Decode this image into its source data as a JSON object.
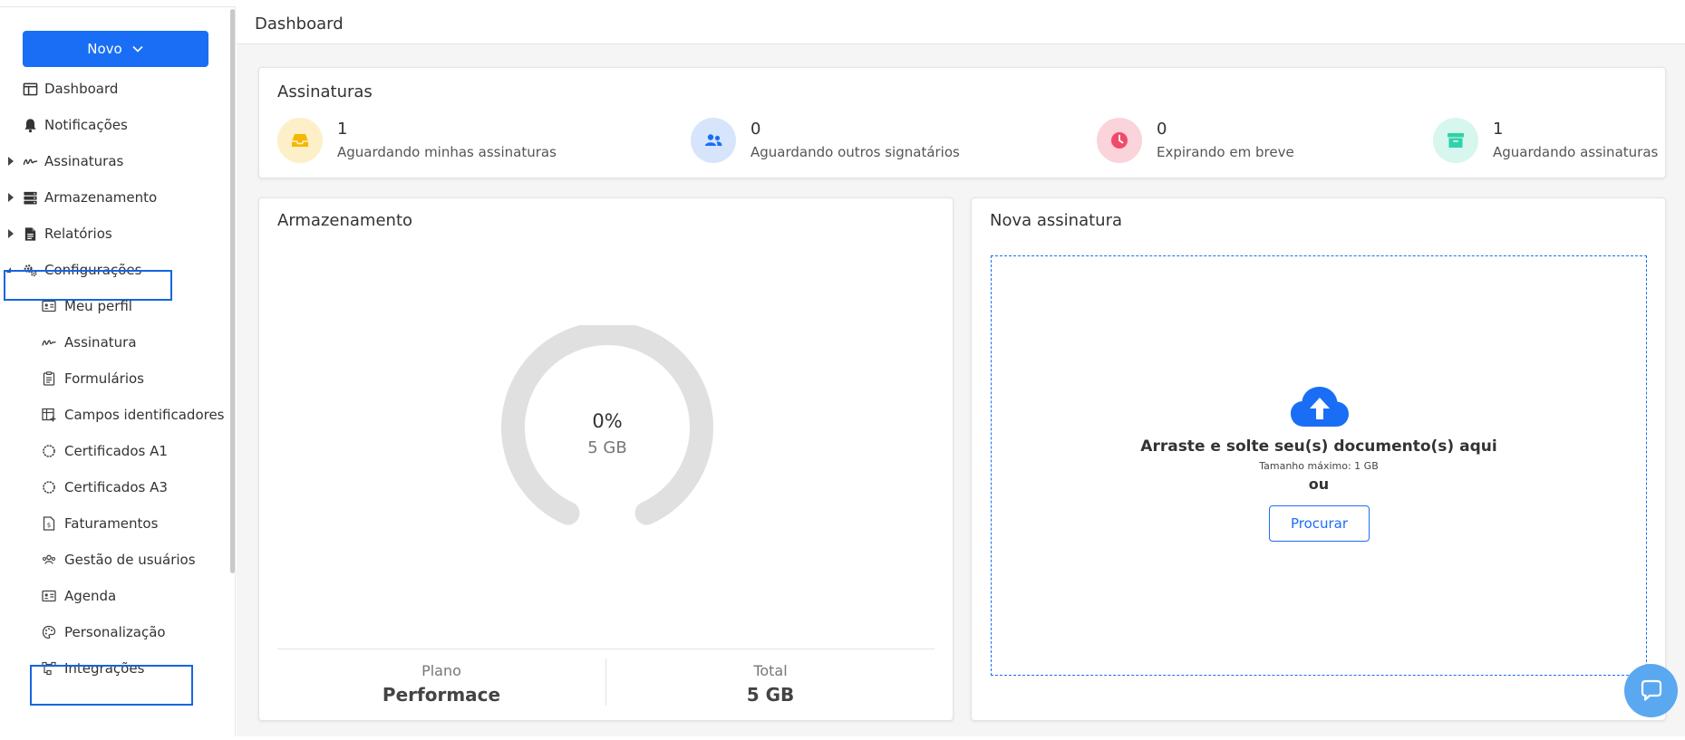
{
  "sidebar": {
    "new_button": "Novo",
    "items": [
      {
        "label": "Dashboard",
        "icon": "dashboard-icon"
      },
      {
        "label": "Notificações",
        "icon": "bell-icon"
      },
      {
        "label": "Assinaturas",
        "icon": "signature-icon",
        "collapsed": true
      },
      {
        "label": "Armazenamento",
        "icon": "storage-icon",
        "collapsed": true
      },
      {
        "label": "Relatórios",
        "icon": "report-icon",
        "collapsed": true
      },
      {
        "label": "Configurações",
        "icon": "gears-icon",
        "expanded": true
      }
    ],
    "sub_items": [
      {
        "label": "Meu perfil",
        "icon": "id-card-icon"
      },
      {
        "label": "Assinatura",
        "icon": "signature-icon"
      },
      {
        "label": "Formulários",
        "icon": "clipboard-icon"
      },
      {
        "label": "Campos identificadores",
        "icon": "table-plus-icon"
      },
      {
        "label": "Certificados A1",
        "icon": "certificate-icon"
      },
      {
        "label": "Certificados A3",
        "icon": "certificate-icon"
      },
      {
        "label": "Faturamentos",
        "icon": "invoice-icon"
      },
      {
        "label": "Gestão de usuários",
        "icon": "users-gear-icon"
      },
      {
        "label": "Agenda",
        "icon": "id-card-icon"
      },
      {
        "label": "Personalização",
        "icon": "palette-icon"
      },
      {
        "label": "Integrações",
        "icon": "integration-icon"
      }
    ]
  },
  "header": {
    "title": "Dashboard"
  },
  "signatures": {
    "title": "Assinaturas",
    "stats": [
      {
        "value": "1",
        "label": "Aguardando minhas assinaturas",
        "icon": "inbox-icon",
        "color": "#f5b800",
        "bg": "#fdf0c8"
      },
      {
        "value": "0",
        "label": "Aguardando outros signatários",
        "icon": "users-icon",
        "color": "#1a6ef5",
        "bg": "#d6e5fb"
      },
      {
        "value": "0",
        "label": "Expirando em breve",
        "icon": "clock-icon",
        "color": "#f04a6b",
        "bg": "#fbd3db"
      },
      {
        "value": "1",
        "label": "Aguardando assinaturas",
        "icon": "archive-icon",
        "color": "#2ed3a8",
        "bg": "#d6f6ee"
      }
    ]
  },
  "storage": {
    "title": "Armazenamento",
    "percent": "0%",
    "used_fraction": 0,
    "size": "5 GB",
    "plan_label": "Plano",
    "plan_value": "Performace",
    "total_label": "Total",
    "total_value": "5 GB"
  },
  "new_signature": {
    "title": "Nova assinatura",
    "drop_text": "Arraste e solte seu(s) documento(s) aqui",
    "max_size": "Tamanho máximo: 1 GB",
    "or": "ou",
    "browse": "Procurar"
  },
  "colors": {
    "primary": "#1a6ef5",
    "highlight": "#1565e0",
    "gauge_track": "#e0e0e0",
    "chat": "#5aa8f0"
  }
}
